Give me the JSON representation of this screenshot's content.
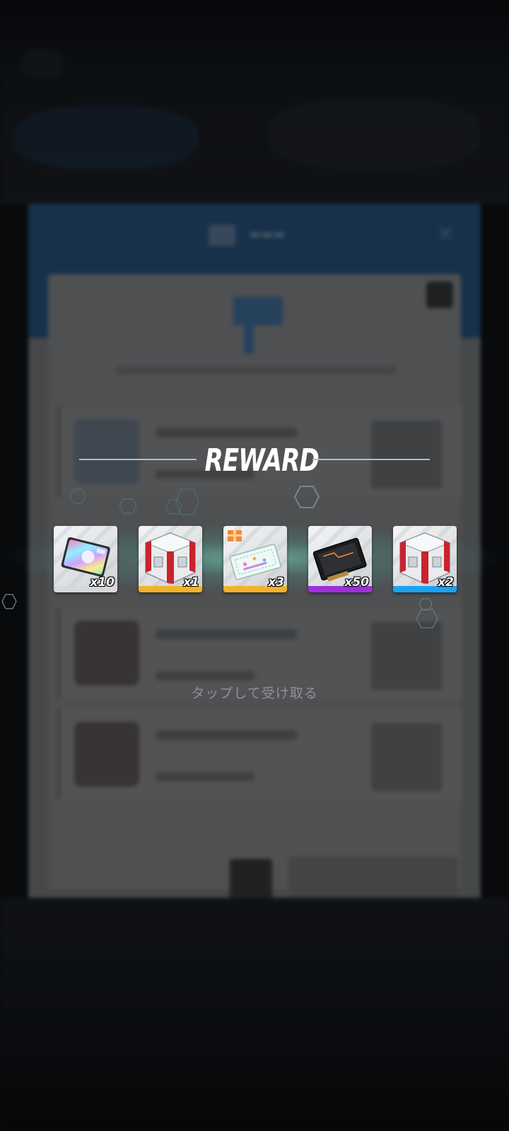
{
  "dialog": {
    "title": "REWARD",
    "tap_hint": "タップして受け取る"
  },
  "rewards": [
    {
      "name": "holo-card",
      "quantity": "x10",
      "rarity_color": "#d6d8da"
    },
    {
      "name": "red-white-crate",
      "quantity": "x1",
      "rarity_color": "#f2b229"
    },
    {
      "name": "gift-ticket",
      "quantity": "x3",
      "rarity_color": "#f2b229"
    },
    {
      "name": "black-data-chip",
      "quantity": "x50",
      "rarity_color": "#a02fdc"
    },
    {
      "name": "red-white-crate",
      "quantity": "x2",
      "rarity_color": "#1aa3f0"
    }
  ],
  "colors": {
    "overlay": "#060709",
    "glow": "#78e6c8",
    "title": "#ffffff"
  }
}
